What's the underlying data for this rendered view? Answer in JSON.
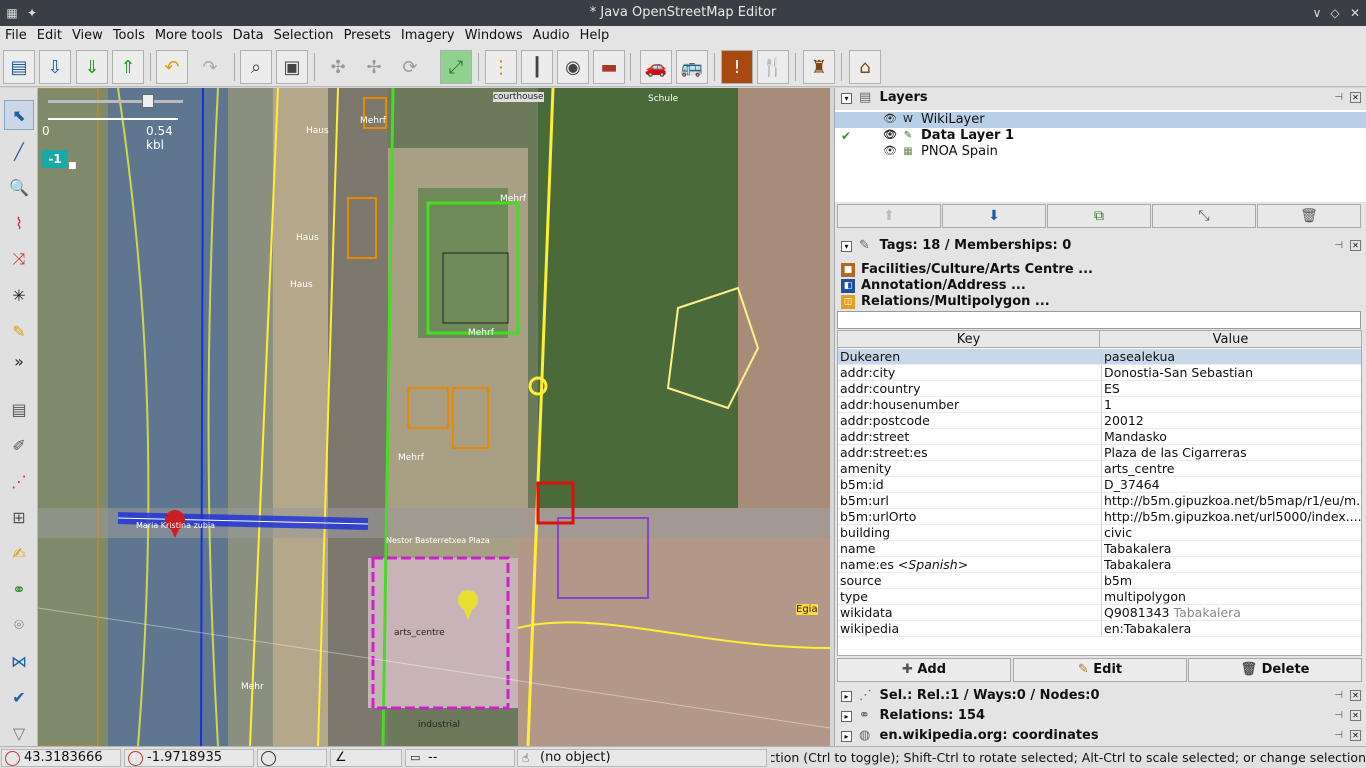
{
  "window": {
    "title": "* Java OpenStreetMap Editor"
  },
  "menu": [
    "File",
    "Edit",
    "View",
    "Tools",
    "More tools",
    "Data",
    "Selection",
    "Presets",
    "Imagery",
    "Windows",
    "Audio",
    "Help"
  ],
  "map": {
    "scale_label": "0.54 kbl",
    "scale_zero": "0",
    "level_badge": "-1",
    "labels": {
      "courthouse": "courthouse",
      "schule": "Schule",
      "mehrf1": "Mehrf",
      "mehrf2": "Mehrf",
      "mehrf3": "Mehrf",
      "haus1": "Haus",
      "haus2": "Haus",
      "haus3": "Haus",
      "mehrf4": "Mehrf",
      "bridge": "Maria Kristina zubia",
      "plaza": "Nestor Basterretxea Plaza",
      "arts_centre": "arts_centre",
      "egia": "Egia",
      "industrial": "industrial",
      "mehr5": "Mehr"
    }
  },
  "layers_panel": {
    "title": "Layers",
    "layers": [
      {
        "name": "WikiLayer",
        "icon": "W",
        "selected": true,
        "active": false
      },
      {
        "name": "Data Layer 1",
        "icon": "✎",
        "selected": false,
        "active": true
      },
      {
        "name": "PNOA Spain",
        "icon": "▦",
        "selected": false,
        "active": false
      }
    ]
  },
  "tags_panel": {
    "title": "Tags: 18 / Memberships: 0",
    "presets": [
      {
        "label": "Facilities/Culture/Arts Centre ...",
        "color": "#b5651d"
      },
      {
        "label": "Annotation/Address ...",
        "color": "#1b4fa0"
      },
      {
        "label": "Relations/Multipolygon ...",
        "color": "#e0a020"
      }
    ],
    "columns": {
      "key": "Key",
      "value": "Value"
    },
    "rows": [
      {
        "key": "Dukearen",
        "value": "pasealekua"
      },
      {
        "key": "addr:city",
        "value": "Donostia-San Sebastian"
      },
      {
        "key": "addr:country",
        "value": "ES"
      },
      {
        "key": "addr:housenumber",
        "value": "1"
      },
      {
        "key": "addr:postcode",
        "value": "20012"
      },
      {
        "key": "addr:street",
        "value": "Mandasko"
      },
      {
        "key": "addr:street:es",
        "value": "Plaza de las Cigarreras"
      },
      {
        "key": "amenity",
        "value": "arts_centre"
      },
      {
        "key": "b5m:id",
        "value": "D_37464"
      },
      {
        "key": "b5m:url",
        "value": "http://b5m.gipuzkoa.net/b5map/r1/eu/m..."
      },
      {
        "key": "b5m:urlOrto",
        "value": "http://b5m.gipuzkoa.net/url5000/index...."
      },
      {
        "key": "building",
        "value": "civic"
      },
      {
        "key": "name",
        "value": "Tabakalera"
      },
      {
        "key": "name:es",
        "key_suffix": "<Spanish>",
        "value": "Tabakalera"
      },
      {
        "key": "source",
        "value": "b5m"
      },
      {
        "key": "type",
        "value": "multipolygon"
      },
      {
        "key": "wikidata",
        "value": "Q9081343",
        "value_extra": "Tabakalera"
      },
      {
        "key": "wikipedia",
        "value": "en:Tabakalera"
      }
    ],
    "buttons": {
      "add": "Add",
      "edit": "Edit",
      "delete": "Delete"
    }
  },
  "collapsed_panels": {
    "selection": "Sel.: Rel.:1 / Ways:0 / Nodes:0",
    "relations": "Relations: 154",
    "wikipedia": "en.wikipedia.org: coordinates"
  },
  "status": {
    "lat": "43.3183666",
    "lon": "-1.9718935",
    "heading": "",
    "angle": "",
    "distance": "--",
    "object": "(no object)",
    "help": "election (Ctrl to toggle); Shift-Ctrl to rotate selected; Alt-Ctrl to scale selected; or change selection"
  }
}
